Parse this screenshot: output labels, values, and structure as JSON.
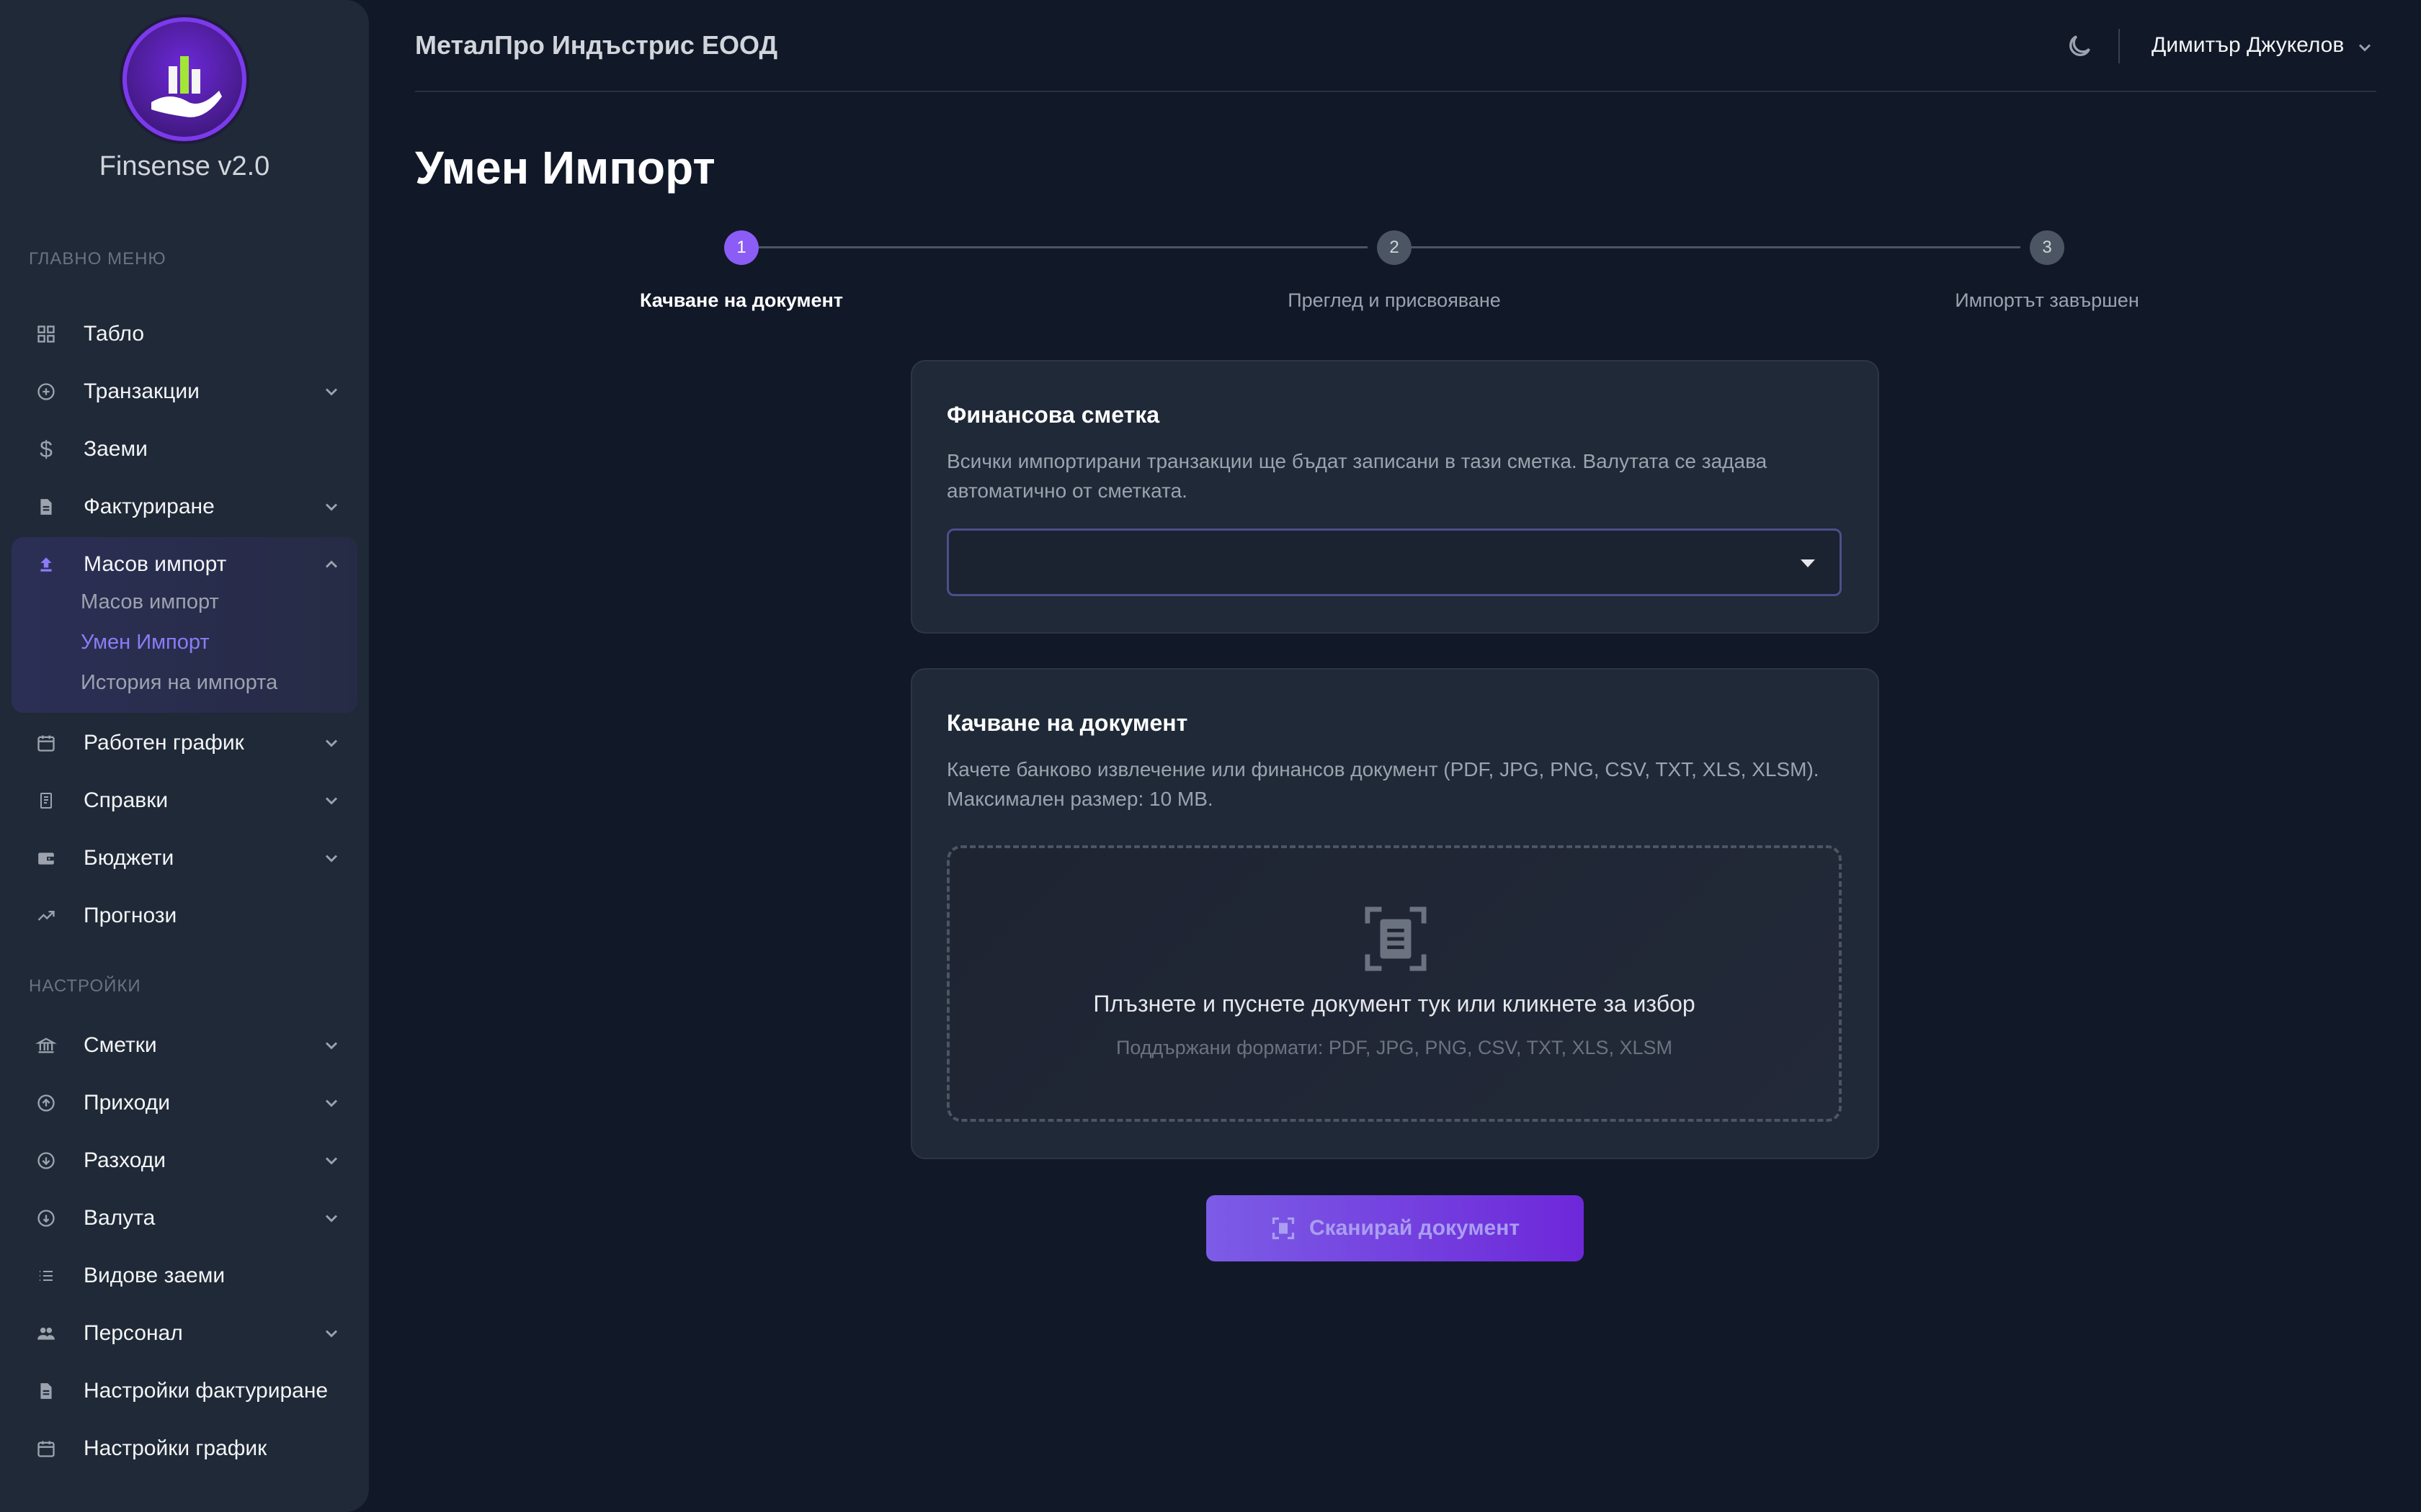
{
  "app": {
    "name": "Finsense v2.0"
  },
  "sidebar": {
    "main_label": "ГЛАВНО МЕНЮ",
    "settings_label": "НАСТРОЙКИ",
    "items": [
      {
        "label": "Табло",
        "icon": "dashboard-grid-icon"
      },
      {
        "label": "Транзакции",
        "icon": "plus-circle-icon"
      },
      {
        "label": "Заеми",
        "icon": "dollar-icon"
      },
      {
        "label": "Фактуриране",
        "icon": "document-icon"
      },
      {
        "label": "Масов импорт",
        "icon": "upload-icon"
      },
      {
        "label": "Работен график",
        "icon": "calendar-icon"
      },
      {
        "label": "Справки",
        "icon": "receipt-icon"
      },
      {
        "label": "Бюджети",
        "icon": "wallet-icon"
      },
      {
        "label": "Прогнози",
        "icon": "trending-up-icon"
      }
    ],
    "subitems": [
      {
        "label": "Масов импорт"
      },
      {
        "label": "Умен Импорт"
      },
      {
        "label": "История на импорта"
      }
    ],
    "settings_items": [
      {
        "label": "Сметки",
        "icon": "bank-icon"
      },
      {
        "label": "Приходи",
        "icon": "arrow-up-circle-icon"
      },
      {
        "label": "Разходи",
        "icon": "arrow-down-circle-icon"
      },
      {
        "label": "Валута",
        "icon": "currency-circle-icon"
      },
      {
        "label": "Видове заеми",
        "icon": "list-icon"
      },
      {
        "label": "Персонал",
        "icon": "people-icon"
      },
      {
        "label": "Настройки фактуриране",
        "icon": "document-icon"
      },
      {
        "label": "Настройки график",
        "icon": "calendar-icon"
      }
    ]
  },
  "header": {
    "company": "МеталПро Индъстрис ЕООД",
    "user": "Димитър Джукелов"
  },
  "page": {
    "title": "Умен Импорт"
  },
  "stepper": {
    "current": 1,
    "steps": [
      {
        "num": "1",
        "label": "Качване на документ"
      },
      {
        "num": "2",
        "label": "Преглед и присвояване"
      },
      {
        "num": "3",
        "label": "Импортът завършен"
      }
    ]
  },
  "account_card": {
    "title": "Финансова сметка",
    "description": "Всички импортирани транзакции ще бъдат записани в тази сметка. Валутата се задава автоматично от сметката.",
    "selected": ""
  },
  "upload_card": {
    "title": "Качване на документ",
    "description": "Качете банково извлечение или финансов документ (PDF, JPG, PNG, CSV, TXT, XLS, XLSM). Максимален размер: 10 MB.",
    "drop_text": "Плъзнете и пуснете документ тук или кликнете за избор",
    "formats": "Поддържани формати: PDF, JPG, PNG, CSV, TXT, XLS, XLSM"
  },
  "actions": {
    "scan": "Сканирай документ"
  },
  "colors": {
    "accent": "#8b5cf6",
    "background": "#111827",
    "sidebar": "#1f2937"
  }
}
